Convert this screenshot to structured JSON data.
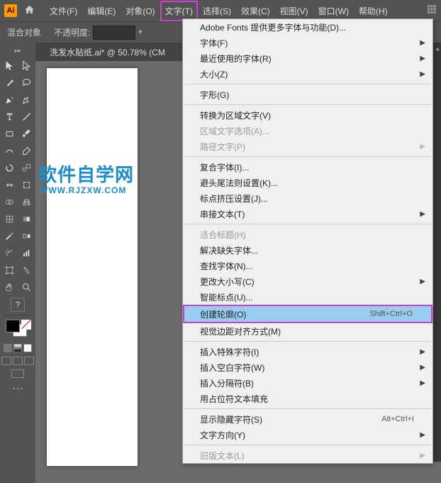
{
  "app_logo": "Ai",
  "menubar": {
    "items": [
      "文件(F)",
      "编辑(E)",
      "对象(O)",
      "文字(T)",
      "选择(S)",
      "效果(C)",
      "视图(V)",
      "窗口(W)",
      "帮助(H)"
    ],
    "highlighted_index": 3
  },
  "optbar": {
    "blend_label": "混合对象",
    "opacity_label": "不透明度:"
  },
  "doc": {
    "tab": "洗发水贴纸.ai* @ 50.78% (CM",
    "watermark1": "软件自学网",
    "watermark2": "WWW.RJZXW.COM"
  },
  "help_tool": "?",
  "dropdown": {
    "groups": [
      [
        {
          "label": "Adobe Fonts 提供更多字体与功能(D)...",
          "sub": false,
          "dis": false
        },
        {
          "label": "字体(F)",
          "sub": true,
          "dis": false
        },
        {
          "label": "最近使用的字体(R)",
          "sub": true,
          "dis": false
        },
        {
          "label": "大小(Z)",
          "sub": true,
          "dis": false
        }
      ],
      [
        {
          "label": "字形(G)",
          "sub": false,
          "dis": false
        }
      ],
      [
        {
          "label": "转换为区域文字(V)",
          "sub": false,
          "dis": false
        },
        {
          "label": "区域文字选项(A)...",
          "sub": false,
          "dis": true
        },
        {
          "label": "路径文字(P)",
          "sub": true,
          "dis": true
        }
      ],
      [
        {
          "label": "复合字体(I)...",
          "sub": false,
          "dis": false
        },
        {
          "label": "避头尾法则设置(K)...",
          "sub": false,
          "dis": false
        },
        {
          "label": "标点挤压设置(J)...",
          "sub": false,
          "dis": false
        },
        {
          "label": "串接文本(T)",
          "sub": true,
          "dis": false
        }
      ],
      [
        {
          "label": "适合标题(H)",
          "sub": false,
          "dis": true
        },
        {
          "label": "解决缺失字体...",
          "sub": false,
          "dis": false
        },
        {
          "label": "查找字体(N)...",
          "sub": false,
          "dis": false
        },
        {
          "label": "更改大小写(C)",
          "sub": true,
          "dis": false
        },
        {
          "label": "智能标点(U)...",
          "sub": false,
          "dis": false
        },
        {
          "label": "创建轮廓(O)",
          "sub": false,
          "dis": false,
          "short": "Shift+Ctrl+O",
          "hl": true
        },
        {
          "label": "视觉边距对齐方式(M)",
          "sub": false,
          "dis": false
        }
      ],
      [
        {
          "label": "插入特殊字符(I)",
          "sub": true,
          "dis": false
        },
        {
          "label": "插入空白字符(W)",
          "sub": true,
          "dis": false
        },
        {
          "label": "插入分隔符(B)",
          "sub": true,
          "dis": false
        },
        {
          "label": "用占位符文本填充",
          "sub": false,
          "dis": false
        }
      ],
      [
        {
          "label": "显示隐藏字符(S)",
          "sub": false,
          "dis": false,
          "short": "Alt+Ctrl+I"
        },
        {
          "label": "文字方向(Y)",
          "sub": true,
          "dis": false
        }
      ],
      [
        {
          "label": "旧版文本(L)",
          "sub": true,
          "dis": true
        }
      ]
    ]
  }
}
